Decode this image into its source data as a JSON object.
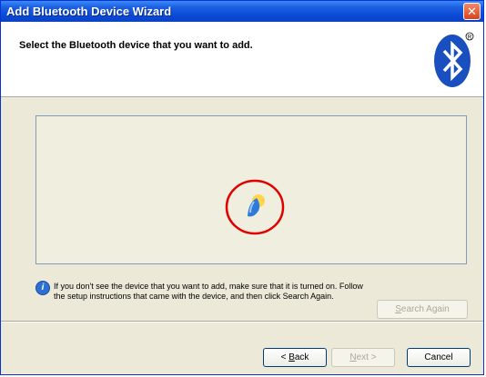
{
  "window": {
    "title": "Add Bluetooth Device Wizard",
    "close_glyph": "✕"
  },
  "header": {
    "instruction": "Select the Bluetooth device that you want to add.",
    "logo_icon": "bluetooth-icon",
    "logo_color": "#1a4fbf"
  },
  "device_list": {
    "status_icon": "searching-icon",
    "highlight_color": "#e00000"
  },
  "info": {
    "icon": "info-icon",
    "text": "If you don't see the device that you want to add, make sure that it is turned on. Follow the setup instructions that came with the device, and then click Search Again."
  },
  "buttons": {
    "search_again": {
      "pre": "",
      "mnemonic": "S",
      "post": "earch Again",
      "enabled": false
    },
    "back": {
      "pre": "< ",
      "mnemonic": "B",
      "post": "ack",
      "enabled": true
    },
    "next": {
      "pre": "",
      "mnemonic": "N",
      "post": "ext >",
      "enabled": false
    },
    "cancel": {
      "pre": "",
      "mnemonic": "",
      "post": "Cancel",
      "enabled": true
    }
  }
}
